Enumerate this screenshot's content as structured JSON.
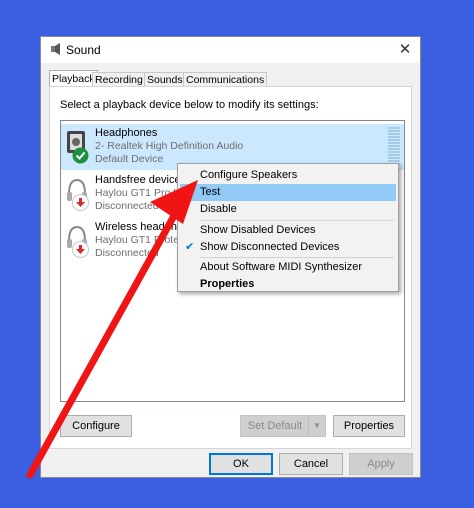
{
  "window": {
    "title": "Sound",
    "close_icon": "close-icon"
  },
  "tabs": [
    {
      "label": "Playback",
      "active": true
    },
    {
      "label": "Recording",
      "active": false
    },
    {
      "label": "Sounds",
      "active": false
    },
    {
      "label": "Communications",
      "active": false
    }
  ],
  "instructions": "Select a playback device below to modify its settings:",
  "devices": [
    {
      "name": "Headphones",
      "detail": "2- Realtek High Definition Audio",
      "status": "Default Device",
      "selected": true,
      "badge": "green-check-icon"
    },
    {
      "name": "Handsfree device",
      "detail": "Haylou GT1 Pro Ha",
      "status": "Disconnected",
      "selected": false,
      "badge": "red-down-arrow-icon"
    },
    {
      "name": "Wireless headph",
      "detail": "Haylou GT1 Prote",
      "status": "Disconnected",
      "selected": false,
      "badge": "red-down-arrow-icon"
    }
  ],
  "context_menu": {
    "items": [
      {
        "label": "Configure Speakers"
      },
      {
        "label": "Test",
        "highlighted": true
      },
      {
        "label": "Disable"
      },
      {
        "label": "Show Disabled Devices"
      },
      {
        "label": "Show Disconnected Devices",
        "checked": true
      },
      {
        "label": "About Software MIDI Synthesizer"
      },
      {
        "label": "Properties",
        "bold": true
      }
    ]
  },
  "buttons": {
    "configure": "Configure",
    "set_default": "Set Default",
    "properties": "Properties",
    "ok": "OK",
    "cancel": "Cancel",
    "apply": "Apply"
  },
  "colors": {
    "background": "#3a5fe0",
    "selection": "#cce8ff",
    "menu_highlight": "#91c9f7",
    "annotation_arrow": "#ff0000"
  }
}
